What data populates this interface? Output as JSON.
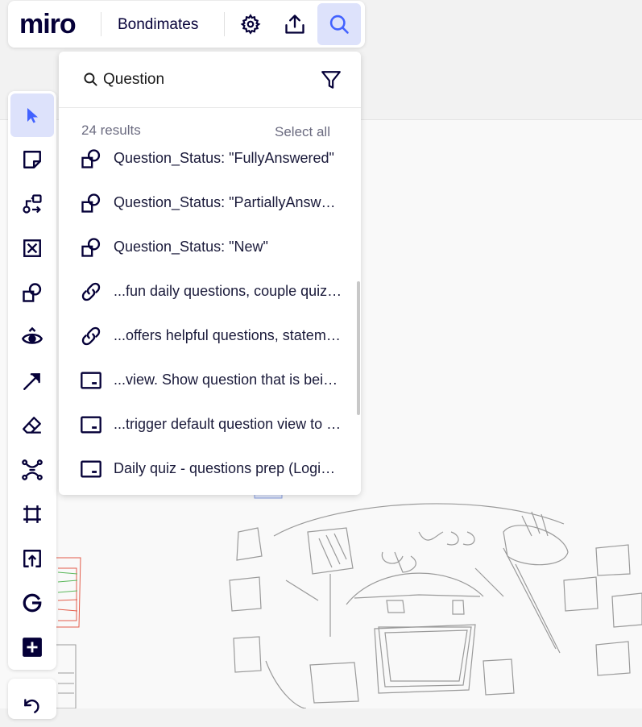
{
  "app": {
    "logo": "miro",
    "board_name": "Bondimates"
  },
  "header": {
    "settings_icon": "gear-icon",
    "share_icon": "upload-icon",
    "search_icon": "search-icon",
    "accent_color": "#4262ff",
    "active_bg": "#dde2fb"
  },
  "toolbar": {
    "tools": [
      {
        "name": "select",
        "icon": "cursor-icon"
      },
      {
        "name": "sticky-note",
        "icon": "sticky-note-icon"
      },
      {
        "name": "templates",
        "icon": "templates-icon"
      },
      {
        "name": "cards",
        "icon": "card-icon"
      },
      {
        "name": "shapes",
        "icon": "shapes-icon"
      },
      {
        "name": "pen",
        "icon": "pen-icon"
      },
      {
        "name": "connection-line",
        "icon": "arrow-icon"
      },
      {
        "name": "eraser",
        "icon": "eraser-icon"
      },
      {
        "name": "mind-map",
        "icon": "mindmap-icon"
      },
      {
        "name": "frame",
        "icon": "frame-icon"
      },
      {
        "name": "upload",
        "icon": "upload-icon"
      },
      {
        "name": "google",
        "icon": "google-icon"
      },
      {
        "name": "more-apps",
        "icon": "plus-icon"
      }
    ],
    "undo_icon": "undo-icon"
  },
  "search": {
    "query": "Question",
    "results_count": "24 results",
    "select_all": "Select all",
    "results": [
      {
        "icon": "shapes-icon",
        "text": "Question_Status: \"FullyAnswered\""
      },
      {
        "icon": "shapes-icon",
        "text": "Question_Status: \"PartiallyAnswered\""
      },
      {
        "icon": "shapes-icon",
        "text": "Question_Status: \"New\""
      },
      {
        "icon": "link-icon",
        "text": "...fun daily questions, couple quizzes"
      },
      {
        "icon": "link-icon",
        "text": "...offers helpful questions, statements"
      },
      {
        "icon": "card-icon",
        "text": "...view. Show question that is being answered"
      },
      {
        "icon": "card-icon",
        "text": "...trigger default question view to open"
      },
      {
        "icon": "card-icon",
        "text": "Daily quiz - questions prep (Login flow)"
      }
    ]
  }
}
